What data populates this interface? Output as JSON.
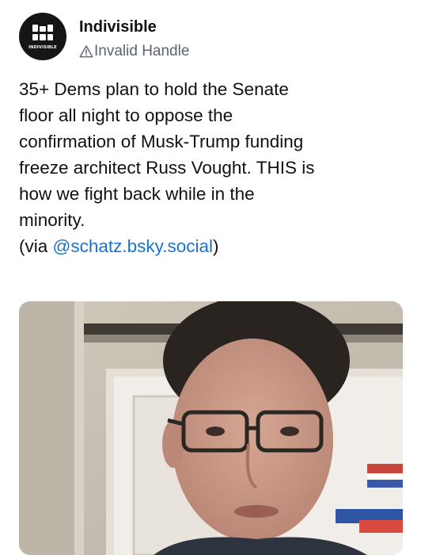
{
  "account": {
    "display_name": "Indivisible",
    "avatar_text": "INDIVISIBLE",
    "handle": "Invalid Handle",
    "handle_icon": "warning-triangle-icon"
  },
  "post": {
    "lines": [
      "35+ Dems plan to hold the Senate",
      "floor all night to oppose the",
      "confirmation of Musk-Trump funding",
      "freeze architect Russ Vought. THIS is",
      "how we fight back while in the",
      "minority."
    ],
    "via_prefix": "(via ",
    "via_mention": "@schatz.bsky.social",
    "via_suffix": ")"
  },
  "colors": {
    "text": "#111111",
    "handle": "#5b6470",
    "link": "#1a73c9",
    "avatar_bg": "#151515"
  }
}
